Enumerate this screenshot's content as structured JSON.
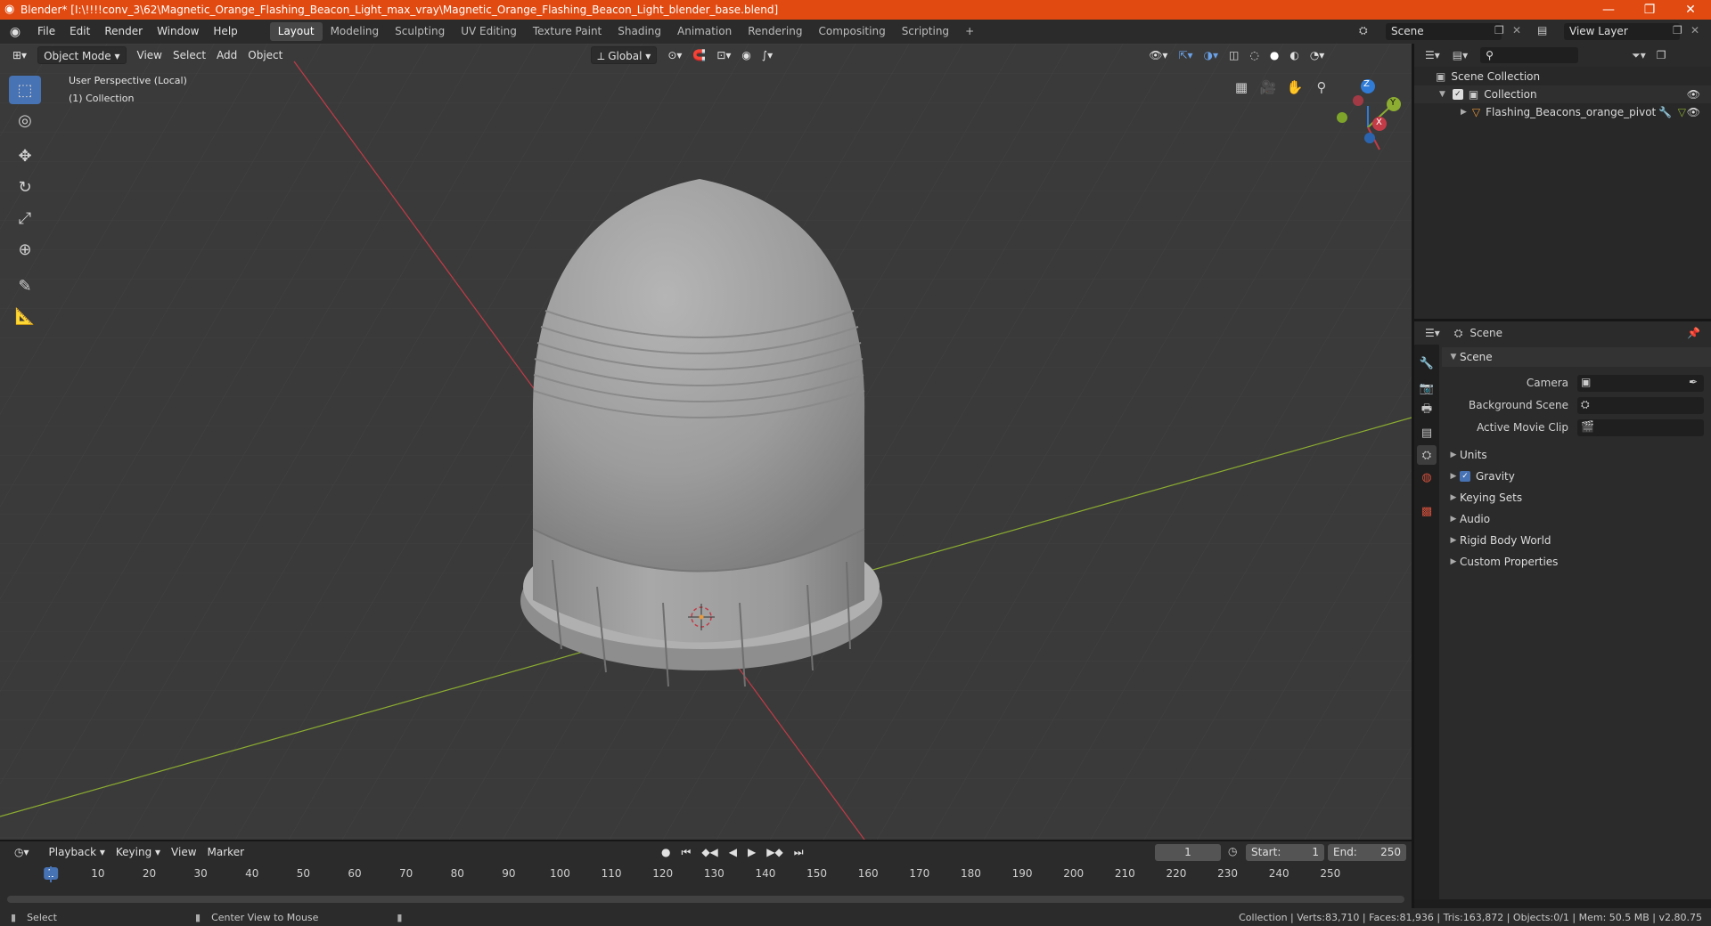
{
  "window": {
    "title": "Blender* [I:\\!!!!conv_3\\62\\Magnetic_Orange_Flashing_Beacon_Light_max_vray\\Magnetic_Orange_Flashing_Beacon_Light_blender_base.blend]",
    "minimize": "—",
    "restore": "❐",
    "close": "✕"
  },
  "menu": {
    "items": [
      "File",
      "Edit",
      "Render",
      "Window",
      "Help"
    ],
    "workspaces": [
      "Layout",
      "Modeling",
      "Sculpting",
      "UV Editing",
      "Texture Paint",
      "Shading",
      "Animation",
      "Rendering",
      "Compositing",
      "Scripting"
    ],
    "add_tab": "+",
    "scene": "Scene",
    "view_layer": "View Layer"
  },
  "viewport": {
    "mode": "Object Mode",
    "menus": [
      "View",
      "Select",
      "Add",
      "Object"
    ],
    "orientation": "Global",
    "overlay_title": "User Perspective (Local)",
    "overlay_collection": "(1) Collection",
    "gizmo": {
      "x": "X",
      "y": "Y",
      "z": "Z"
    }
  },
  "outliner": {
    "search_placeholder": "",
    "scene_collection": "Scene Collection",
    "collection": "Collection",
    "object": "Flashing_Beacons_orange_pivot"
  },
  "properties": {
    "context": "Scene",
    "panel_title": "Scene",
    "camera_label": "Camera",
    "background_scene_label": "Background Scene",
    "active_movie_clip_label": "Active Movie Clip",
    "panels": [
      "Units",
      "Gravity",
      "Keying Sets",
      "Audio",
      "Rigid Body World",
      "Custom Properties"
    ]
  },
  "timeline": {
    "menus": [
      "Playback",
      "Keying",
      "View",
      "Marker"
    ],
    "current_frame": "1",
    "start_label": "Start:",
    "start": "1",
    "end_label": "End:",
    "end": "250",
    "ticks": [
      "1",
      "10",
      "20",
      "30",
      "40",
      "50",
      "60",
      "70",
      "80",
      "90",
      "100",
      "110",
      "120",
      "130",
      "140",
      "150",
      "160",
      "170",
      "180",
      "190",
      "200",
      "210",
      "220",
      "230",
      "240",
      "250"
    ]
  },
  "status": {
    "select": "Select",
    "center_view": "Center View to Mouse",
    "stats": "Collection | Verts:83,710 | Faces:81,936 | Tris:163,872 | Objects:0/1 | Mem: 50.5 MB | v2.80.75"
  },
  "colors": {
    "title_bar": "#e14a11",
    "accent": "#4772b3",
    "x_axis": "#c33b47",
    "y_axis": "#8cad31",
    "z_axis": "#2f7bd6",
    "object_orange": "#e89a3c"
  }
}
